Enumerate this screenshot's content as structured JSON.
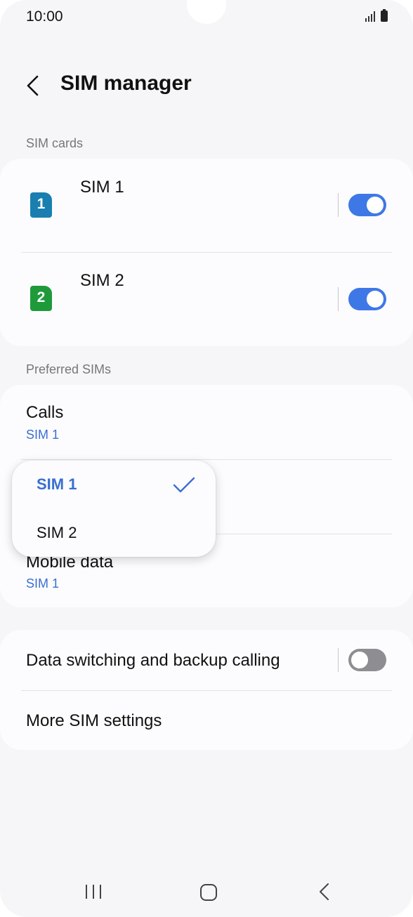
{
  "status_bar": {
    "time": "10:00",
    "icons": [
      "signal-icon",
      "battery-icon"
    ]
  },
  "header": {
    "title": "SIM manager",
    "back_icon": "chevron-left-icon"
  },
  "sim_cards": {
    "section_label": "SIM cards",
    "items": [
      {
        "name": "SIM 1",
        "badge": "1",
        "badge_color": "#1a7fb0",
        "enabled": true
      },
      {
        "name": "SIM 2",
        "badge": "2",
        "badge_color": "#1e9a3a",
        "enabled": true
      }
    ]
  },
  "preferred": {
    "section_label": "Preferred SIMs",
    "rows": [
      {
        "title": "Calls",
        "value": "SIM 1"
      },
      {
        "title": "Mobile data",
        "value": "SIM 1"
      }
    ]
  },
  "popup": {
    "options": [
      {
        "label": "SIM 1",
        "selected": true
      },
      {
        "label": "SIM 2",
        "selected": false
      }
    ]
  },
  "other": {
    "data_switching_label": "Data switching and backup calling",
    "data_switching_enabled": false,
    "more_settings_label": "More SIM settings"
  },
  "colors": {
    "accent": "#3e78e6",
    "link_text": "#3a6fd0",
    "background": "#f6f6f8",
    "card": "#fcfcfe"
  },
  "nav_bar": {
    "icons": [
      "recents-icon",
      "home-icon",
      "back-icon"
    ]
  }
}
